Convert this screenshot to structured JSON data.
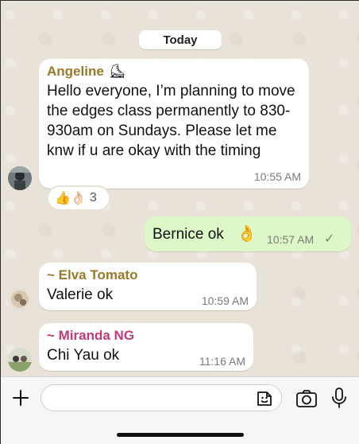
{
  "date_divider": "Today",
  "messages": [
    {
      "sender": "Angeline",
      "sender_emoji": "⛸",
      "sender_color": "#9a7a2a",
      "text": "Hello everyone, I’m planning to move the edges class permanently to 830-930am on Sundays. Please let me knw if u are okay with the timing",
      "time": "10:55 AM",
      "reactions": {
        "emojis": "👍👌🏻",
        "count": "3"
      }
    },
    {
      "sender": "",
      "text": "Bernice ok",
      "emoji": "👌",
      "time": "10:57 AM",
      "status": "✓",
      "outgoing": true
    },
    {
      "sender": "~ Elva Tomato",
      "sender_color": "#9a7a2a",
      "text": "Valerie ok",
      "time": "10:59 AM"
    },
    {
      "sender": "~ Miranda NG",
      "sender_color": "#c23a78",
      "text": "Chi Yau ok",
      "time": "11:16 AM"
    }
  ],
  "composer": {
    "placeholder": "",
    "icons": [
      "plus-icon",
      "sticker-icon",
      "camera-icon",
      "microphone-icon"
    ]
  },
  "colors": {
    "outgoing_bubble": "#dcf8c6",
    "incoming_bubble": "#ffffff",
    "chat_background": "#e8e2d8"
  }
}
